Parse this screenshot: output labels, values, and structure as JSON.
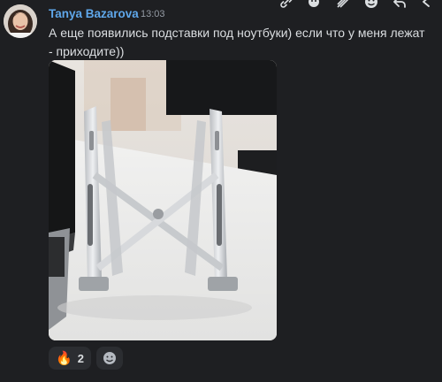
{
  "message": {
    "author": "Tanya Bazarova",
    "timestamp": "13:03",
    "text": "А еще появились подставки под ноутбуки) если что у меня лежат - приходите))",
    "author_color": "#5fa7ea"
  },
  "toolbar": {
    "icons": [
      "link-icon",
      "add-reaction-icon",
      "strikethrough-icon",
      "emoji-icon",
      "reply-icon",
      "back-icon"
    ]
  },
  "attachment": {
    "type": "image"
  },
  "reactions": [
    {
      "emoji": "🔥",
      "count": "2"
    }
  ],
  "add_reaction_icon": "emoji-icon"
}
